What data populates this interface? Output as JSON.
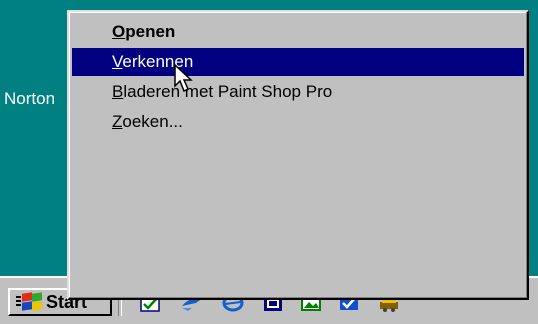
{
  "desktop": {
    "icon_label": "Norton"
  },
  "taskbar": {
    "start_label": "Start",
    "quick_launch_icons": [
      "check-icon",
      "arrow-icon",
      "browser-icon",
      "window-icon",
      "picture-icon",
      "check-square-icon",
      "tool-icon"
    ]
  },
  "context_menu": {
    "items": [
      {
        "accel": "O",
        "rest": "penen",
        "bold": true,
        "selected": false
      },
      {
        "accel": "V",
        "rest": "erkennen",
        "bold": false,
        "selected": true
      },
      {
        "accel": "B",
        "rest": "laderen met Paint Shop Pro",
        "bold": false,
        "selected": false
      },
      {
        "accel": "Z",
        "rest": "oeken...",
        "bold": false,
        "selected": false
      }
    ]
  },
  "colors": {
    "desktop": "#008080",
    "menu_bg": "#c0c0c0",
    "highlight": "#000080",
    "highlight_text": "#ffffff"
  }
}
